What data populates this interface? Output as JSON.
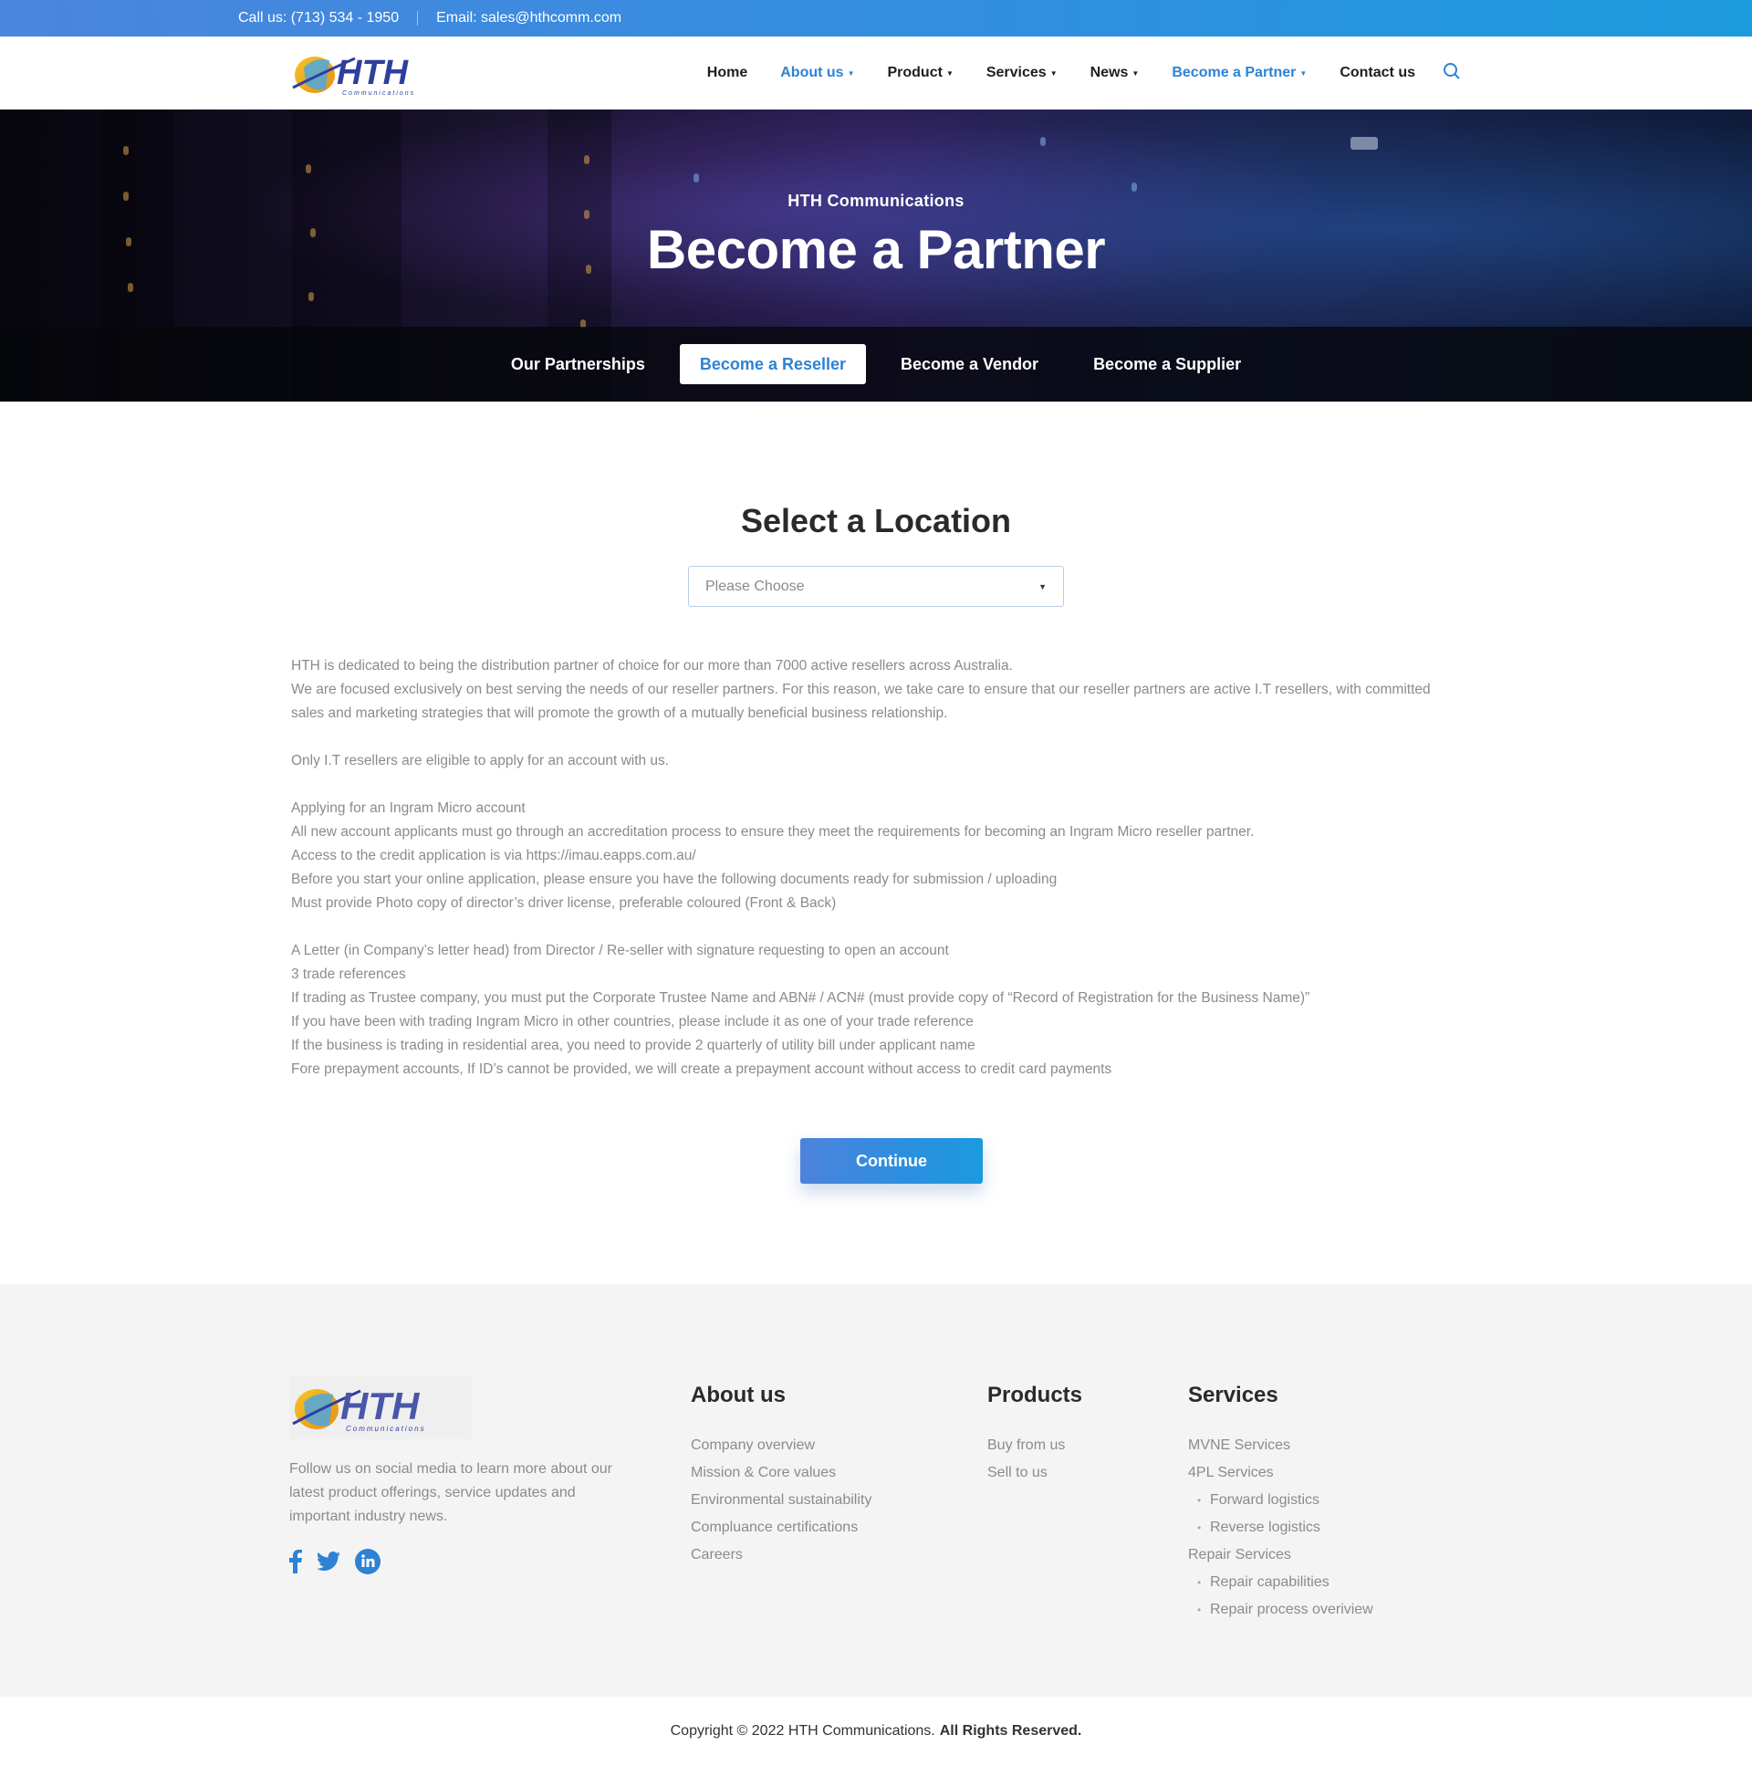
{
  "topbar": {
    "phone": "Call us: (713) 534 - 1950",
    "email": "Email: sales@hthcomm.com"
  },
  "header": {
    "logo_text": "HTH",
    "logo_sub": "Communications",
    "nav": [
      {
        "label": "Home",
        "active": false,
        "dropdown": false
      },
      {
        "label": "About us",
        "active": true,
        "dropdown": true
      },
      {
        "label": "Product",
        "active": false,
        "dropdown": true
      },
      {
        "label": "Services",
        "active": false,
        "dropdown": true
      },
      {
        "label": "News",
        "active": false,
        "dropdown": true
      },
      {
        "label": "Become a Partner",
        "active": true,
        "dropdown": true
      },
      {
        "label": "Contact us",
        "active": false,
        "dropdown": false
      }
    ],
    "search_icon": "search-icon"
  },
  "hero": {
    "subtitle": "HTH Communications",
    "title": "Become a Partner",
    "tabs": [
      {
        "label": "Our Partnerships",
        "active": false
      },
      {
        "label": "Become a Reseller",
        "active": true
      },
      {
        "label": "Become a Vendor",
        "active": false
      },
      {
        "label": "Become a Supplier",
        "active": false
      }
    ]
  },
  "main": {
    "title": "Select a Location",
    "select_placeholder": "Please Choose",
    "paragraphs": [
      "HTH is dedicated to being the distribution partner of choice for our more than 7000 active resellers across Australia.",
      "We are focused exclusively on best serving the needs of our reseller partners. For this reason, we take care to ensure that our reseller partners are active I.T resellers, with committed sales and marketing strategies that will promote the growth of a mutually beneficial business relationship.",
      "",
      "Only I.T resellers are eligible to apply for an account with us.",
      "",
      "Applying for an Ingram Micro account",
      "All new account applicants must go through an accreditation process to ensure they meet the requirements for becoming an Ingram Micro reseller partner.",
      "Access to the credit application is via https://imau.eapps.com.au/",
      "Before you start your online application, please ensure you have the following documents ready for submission / uploading",
      "Must provide Photo copy of director’s driver license, preferable coloured (Front & Back)",
      "",
      "A Letter (in Company’s letter head) from Director / Re-seller with signature requesting to open an account",
      "3 trade references",
      "If trading as Trustee company, you must put the Corporate Trustee Name and ABN# / ACN# (must provide copy of “Record of Registration for the Business Name)”",
      "If you have been with trading Ingram Micro in other countries, please include it as one of your trade reference",
      "If the business is trading in residential  area, you need to provide 2 quarterly of utility bill under applicant name",
      "Fore prepayment accounts, If ID’s cannot be provided, we will create a prepayment account without access to credit card payments"
    ],
    "cta_label": "Continue"
  },
  "footer": {
    "description": "Follow us on social media to learn more about our latest product offerings, service updates and important industry news.",
    "social": [
      "facebook-icon",
      "twitter-icon",
      "linkedin-icon"
    ],
    "about": {
      "title": "About us",
      "links": [
        "Company overview",
        "Mission & Core values",
        "Environmental sustainability",
        "Compluance certifications",
        "Careers"
      ]
    },
    "products": {
      "title": "Products",
      "links": [
        "Buy from us",
        "Sell to us"
      ]
    },
    "services": {
      "title": "Services",
      "links": [
        {
          "label": "MVNE Services",
          "sub": false
        },
        {
          "label": "4PL Services",
          "sub": false
        },
        {
          "label": "Forward logistics",
          "sub": true
        },
        {
          "label": "Reverse logistics",
          "sub": true
        },
        {
          "label": "Repair Services",
          "sub": false
        },
        {
          "label": "Repair capabilities",
          "sub": true
        },
        {
          "label": "Repair process overiview",
          "sub": true
        }
      ]
    },
    "copyright": "Copyright © 2022 HTH Communications.",
    "rights": "All Rights Reserved."
  },
  "colors": {
    "accent": "#2d82d4",
    "topbar_start": "#4a86dd",
    "topbar_end": "#1c9ade",
    "logo_blue": "#2e3f9c",
    "logo_gold": "#f2b31f"
  }
}
